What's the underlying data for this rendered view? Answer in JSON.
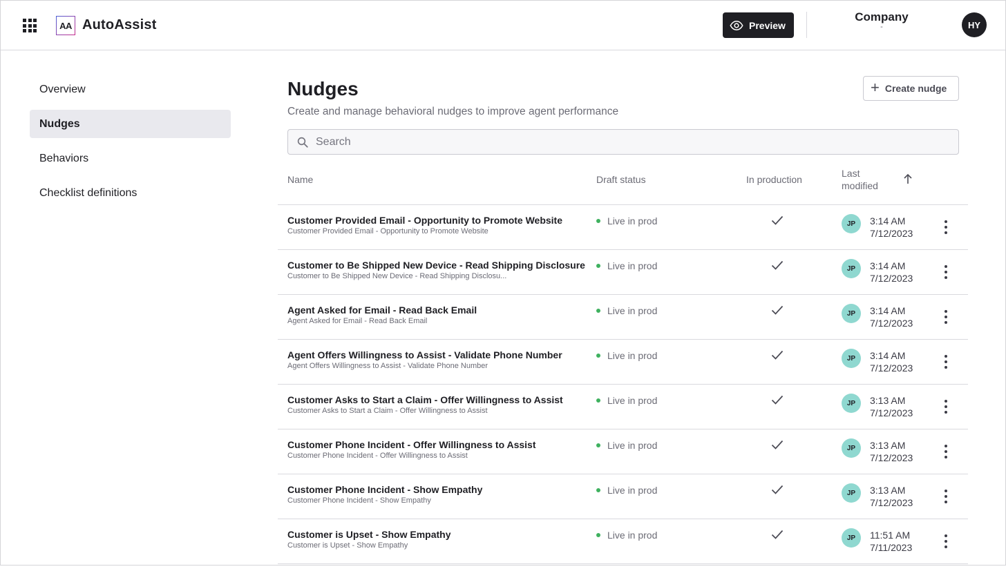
{
  "header": {
    "app_title": "AutoAssist",
    "logo_text": "AA",
    "preview_label": "Preview",
    "company_name": "Company",
    "company_sub": "-",
    "user_initials": "HY"
  },
  "sidebar": {
    "items": [
      {
        "label": "Overview",
        "active": false
      },
      {
        "label": "Nudges",
        "active": true
      },
      {
        "label": "Behaviors",
        "active": false
      },
      {
        "label": "Checklist definitions",
        "active": false
      }
    ]
  },
  "main": {
    "title": "Nudges",
    "subtitle": "Create and manage behavioral nudges to improve agent performance",
    "create_button": "Create nudge",
    "search_placeholder": "Search"
  },
  "table": {
    "columns": {
      "name": "Name",
      "draft_status": "Draft status",
      "in_production": "In production",
      "last_modified": "Last modified"
    },
    "rows": [
      {
        "title": "Customer Provided Email - Opportunity to Promote Website",
        "desc": "Customer Provided Email - Opportunity to Promote Website",
        "status": "Live in prod",
        "in_production": true,
        "initials": "JP",
        "time": "3:14 AM",
        "date": "7/12/2023"
      },
      {
        "title": "Customer to Be Shipped New Device - Read Shipping Disclosure",
        "desc": "Customer to Be Shipped New Device - Read Shipping Disclosu...",
        "status": "Live in prod",
        "in_production": true,
        "initials": "JP",
        "time": "3:14 AM",
        "date": "7/12/2023"
      },
      {
        "title": "Agent Asked for Email - Read Back Email",
        "desc": "Agent Asked for Email - Read Back Email",
        "status": "Live in prod",
        "in_production": true,
        "initials": "JP",
        "time": "3:14 AM",
        "date": "7/12/2023"
      },
      {
        "title": "Agent Offers Willingness to Assist - Validate Phone Number",
        "desc": "Agent Offers Willingness to Assist - Validate Phone Number",
        "status": "Live in prod",
        "in_production": true,
        "initials": "JP",
        "time": "3:14 AM",
        "date": "7/12/2023"
      },
      {
        "title": "Customer Asks to Start a Claim - Offer Willingness to Assist",
        "desc": "Customer Asks to Start a Claim - Offer Willingness to Assist",
        "status": "Live in prod",
        "in_production": true,
        "initials": "JP",
        "time": "3:13 AM",
        "date": "7/12/2023"
      },
      {
        "title": "Customer Phone Incident - Offer Willingness to Assist",
        "desc": "Customer Phone Incident - Offer Willingness to Assist",
        "status": "Live in prod",
        "in_production": true,
        "initials": "JP",
        "time": "3:13 AM",
        "date": "7/12/2023"
      },
      {
        "title": "Customer Phone Incident - Show Empathy",
        "desc": "Customer Phone Incident - Show Empathy",
        "status": "Live in prod",
        "in_production": true,
        "initials": "JP",
        "time": "3:13 AM",
        "date": "7/12/2023"
      },
      {
        "title": "Customer is Upset - Show Empathy",
        "desc": "Customer is Upset - Show Empathy",
        "status": "Live in prod",
        "in_production": true,
        "initials": "JP",
        "time": "11:51 AM",
        "date": "7/11/2023"
      }
    ]
  },
  "colors": {
    "status_dot": "#3fb15f",
    "avatar_teal": "#8fd8d0",
    "dark": "#1f1f24"
  }
}
